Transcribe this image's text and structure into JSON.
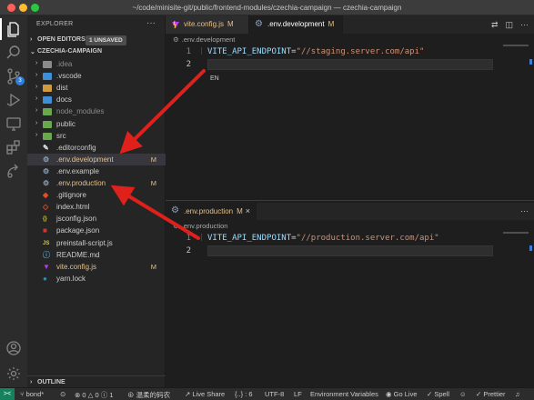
{
  "window": {
    "title": "~/code/minisite-git/public/frontend-modules/czechia-campaign — czechia-campaign"
  },
  "activity_bar": {
    "items": [
      {
        "name": "explorer",
        "icon": "files-icon"
      },
      {
        "name": "search",
        "icon": "search-icon"
      },
      {
        "name": "source-control",
        "icon": "source-control-icon",
        "badge": "3"
      },
      {
        "name": "run-debug",
        "icon": "run-debug-icon"
      },
      {
        "name": "remote-explorer",
        "icon": "remote-explorer-icon"
      },
      {
        "name": "extensions",
        "icon": "extensions-icon"
      },
      {
        "name": "live-share",
        "icon": "live-share-icon"
      },
      {
        "name": "accounts",
        "icon": "account-icon"
      },
      {
        "name": "manage",
        "icon": "gear-icon"
      }
    ]
  },
  "explorer": {
    "title": "EXPLORER",
    "more": "···",
    "open_editors": {
      "label": "OPEN EDITORS",
      "unsaved_badge": "1 UNSAVED"
    },
    "project": {
      "label": "CZECHIA-CAMPAIGN"
    },
    "items": [
      {
        "name": ".idea",
        "kind": "folder",
        "color": "#8b8b8b",
        "dim": true,
        "status": ""
      },
      {
        "name": ".vscode",
        "kind": "folder",
        "color": "#3f8fd6",
        "dim": false,
        "status": ""
      },
      {
        "name": "dist",
        "kind": "folder",
        "color": "#d19a3d",
        "dim": false,
        "status": ""
      },
      {
        "name": "docs",
        "kind": "folder",
        "color": "#3f8fd6",
        "dim": false,
        "status": ""
      },
      {
        "name": "node_modules",
        "kind": "folder",
        "color": "#6aa84f",
        "dim": true,
        "status": ""
      },
      {
        "name": "public",
        "kind": "folder",
        "color": "#6aa84f",
        "dim": false,
        "status": ""
      },
      {
        "name": "src",
        "kind": "folder",
        "color": "#6aa84f",
        "dim": false,
        "status": ""
      },
      {
        "name": ".editorconfig",
        "kind": "file",
        "icon": "editorconfig-icon",
        "color": "#e8e8e8",
        "status": ""
      },
      {
        "name": ".env.development",
        "kind": "file",
        "icon": "gear-icon",
        "color": "#8fa0b2",
        "status": "M",
        "modified": true,
        "selected": true
      },
      {
        "name": ".env.example",
        "kind": "file",
        "icon": "gear-icon",
        "color": "#8fa0b2",
        "status": ""
      },
      {
        "name": ".env.production",
        "kind": "file",
        "icon": "gear-icon",
        "color": "#8fa0b2",
        "status": "M",
        "modified": true
      },
      {
        "name": ".gitignore",
        "kind": "file",
        "icon": "git-icon",
        "color": "#e44d26",
        "status": ""
      },
      {
        "name": "index.html",
        "kind": "file",
        "icon": "html-icon",
        "color": "#e44d26",
        "status": ""
      },
      {
        "name": "jsconfig.json",
        "kind": "file",
        "icon": "json-icon",
        "color": "#cbcb41",
        "status": ""
      },
      {
        "name": "package.json",
        "kind": "file",
        "icon": "npm-icon",
        "color": "#cb3837",
        "status": ""
      },
      {
        "name": "preinstall-script.js",
        "kind": "file",
        "icon": "js-icon",
        "color": "#cbcb41",
        "status": ""
      },
      {
        "name": "README.md",
        "kind": "file",
        "icon": "info-icon",
        "color": "#519aba",
        "status": ""
      },
      {
        "name": "vite.config.js",
        "kind": "file",
        "icon": "vite-icon",
        "color": "#bd34fe",
        "status": "M",
        "modified": true
      },
      {
        "name": "yarn.lock",
        "kind": "file",
        "icon": "yarn-icon",
        "color": "#2c8ebb",
        "status": ""
      }
    ],
    "outline": {
      "label": "OUTLINE"
    }
  },
  "tabs": [
    {
      "label": "vite.config.js",
      "status": "M",
      "icon": "vite-icon"
    },
    {
      "label": ".env.development",
      "status": "M",
      "icon": "gear-icon",
      "active": true
    }
  ],
  "editor_top": {
    "tab_bar": [
      {
        "label": "vite.config.js",
        "status": "M"
      },
      {
        "label": ".env.development",
        "status": "M"
      }
    ],
    "breadcrumb": ".env.development",
    "lines": [
      {
        "number": "1",
        "key": "VITE_API_ENDPOINT",
        "eq": "=",
        "value": "\"//staging.server.com/api\""
      },
      {
        "number": "2",
        "key": "",
        "eq": "",
        "value": ""
      }
    ],
    "ime_hint": "EN"
  },
  "editor_bottom": {
    "tab": {
      "label": ".env.production",
      "status": "M"
    },
    "breadcrumb": ".env.production",
    "lines": [
      {
        "number": "1",
        "key": "VITE_API_ENDPOINT",
        "eq": "=",
        "value": "\"//production.server.com/api\""
      },
      {
        "number": "2",
        "key": "",
        "eq": "",
        "value": ""
      }
    ]
  },
  "status_bar": {
    "remote": "><",
    "branch": "bond*",
    "errors": "0",
    "warnings": "0",
    "info": "1",
    "author": "温柔的码农",
    "live_share": "Live Share",
    "selection": "{..} : 6",
    "encoding": "UTF-8",
    "eol": "LF",
    "env_vars": "Environment Variables",
    "go_live": "Go Live",
    "spell": "Spell",
    "prettier": "Prettier"
  },
  "colors": {
    "accent": "#007acc",
    "modified": "#e2c08d",
    "annotation_arrow": "#e0201b"
  }
}
